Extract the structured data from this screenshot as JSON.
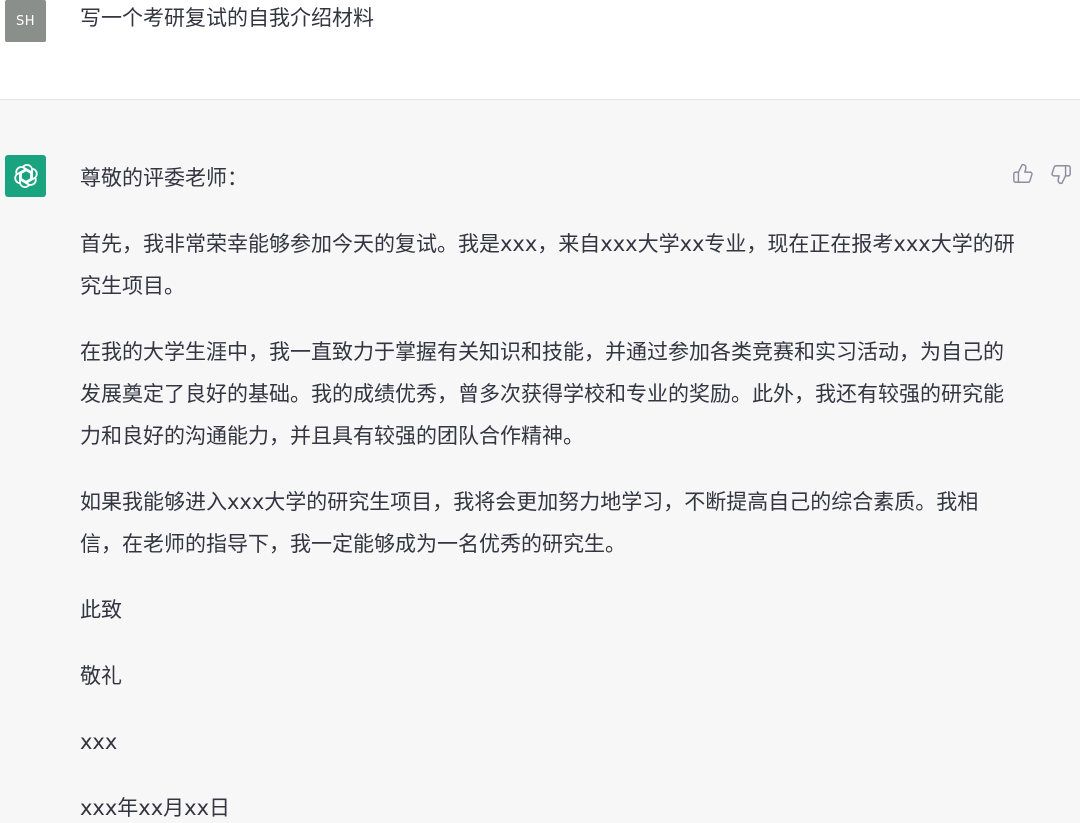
{
  "user_message": {
    "avatar_initials": "SH",
    "text": "写一个考研复试的自我介绍材料"
  },
  "assistant_message": {
    "paragraphs": [
      "尊敬的评委老师：",
      "首先，我非常荣幸能够参加今天的复试。我是xxx，来自xxx大学xx专业，现在正在报考xxx大学的研究生项目。",
      "在我的大学生涯中，我一直致力于掌握有关知识和技能，并通过参加各类竞赛和实习活动，为自己的发展奠定了良好的基础。我的成绩优秀，曾多次获得学校和专业的奖励。此外，我还有较强的研究能力和良好的沟通能力，并且具有较强的团队合作精神。",
      "如果我能够进入xxx大学的研究生项目，我将会更加努力地学习，不断提高自己的综合素质。我相信，在老师的指导下，我一定能够成为一名优秀的研究生。",
      "此致",
      "敬礼",
      "xxx",
      "xxx年xx月xx日"
    ]
  },
  "icons": {
    "assistant_avatar": "openai-logo-icon",
    "thumbs_up": "thumbs-up-icon",
    "thumbs_down": "thumbs-down-icon"
  },
  "colors": {
    "assistant_avatar_bg": "#19a37f",
    "user_avatar_bg": "#8b8f8b",
    "assistant_row_bg": "#f7f7f8",
    "user_row_bg": "#ffffff",
    "text": "#343541"
  }
}
